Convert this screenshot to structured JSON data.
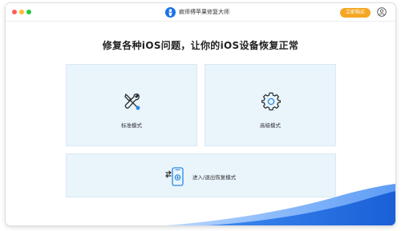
{
  "window": {
    "title": "疯师傅苹果修复大师",
    "buy_label": "立即购买",
    "logo_icon": "app-logo-icon",
    "user_icon": "user-icon"
  },
  "main": {
    "headline": "修复各种iOS问题，让你的iOS设备恢复正常",
    "cards": [
      {
        "label": "标准模式",
        "icon": "tools-icon"
      },
      {
        "label": "高级模式",
        "icon": "gear-icon"
      },
      {
        "label": "进入/退出恢复模式",
        "icon": "phone-sync-icon"
      }
    ]
  },
  "colors": {
    "accent": "#1a73e8",
    "buy": "#f5a623",
    "card_bg": "#e9f4fb"
  }
}
